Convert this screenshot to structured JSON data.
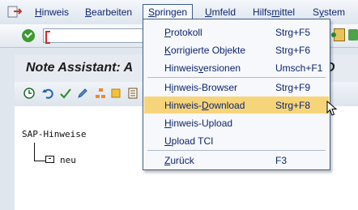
{
  "menubar": {
    "items": [
      {
        "name": "hinweis",
        "label": "Hinweis",
        "u": 0
      },
      {
        "name": "bearbeiten",
        "label": "Bearbeiten",
        "u": 0
      },
      {
        "name": "springen",
        "label": "Springen",
        "u": 0
      },
      {
        "name": "umfeld",
        "label": "Umfeld",
        "u": 0
      },
      {
        "name": "hilfsmittel",
        "label": "Hilfsmittel",
        "u": 5
      },
      {
        "name": "system",
        "label": "System",
        "u": 1
      }
    ]
  },
  "title": {
    "text": "Note Assistant: A",
    "tail": "D"
  },
  "tree": {
    "root_label": "SAP-Hinweise",
    "child_label": "neu"
  },
  "dropdown": {
    "items": [
      {
        "name": "protokoll",
        "label": "Protokoll",
        "u": 0,
        "shortcut": "Strg+F5",
        "highlighted": false
      },
      {
        "name": "korrigierte-objekte",
        "label": "Korrigierte Objekte",
        "u": 0,
        "shortcut": "Strg+F6",
        "highlighted": false
      },
      {
        "name": "hinweisversionen",
        "label": "Hinweisversionen",
        "u": 7,
        "shortcut": "Umsch+F1",
        "highlighted": false
      },
      {
        "name": "hinweis-browser",
        "label": "Hinweis-Browser",
        "u": 1,
        "shortcut": "Strg+F9",
        "highlighted": false
      },
      {
        "name": "hinweis-download",
        "label": "Hinweis-Download",
        "u": 8,
        "shortcut": "Strg+F8",
        "highlighted": true
      },
      {
        "name": "hinweis-upload",
        "label": "Hinweis-Upload",
        "u": 0,
        "shortcut": "",
        "highlighted": false
      },
      {
        "name": "upload-tci",
        "label": "Upload TCI",
        "u": 0,
        "shortcut": "",
        "highlighted": false
      },
      {
        "name": "zurueck",
        "label": "Zurück",
        "u": 0,
        "shortcut": "F3",
        "highlighted": false
      }
    ]
  },
  "colors": {
    "highlight": "#f6d57a",
    "menu_text": "#0e246f",
    "ok_green": "#3b9b2d"
  }
}
